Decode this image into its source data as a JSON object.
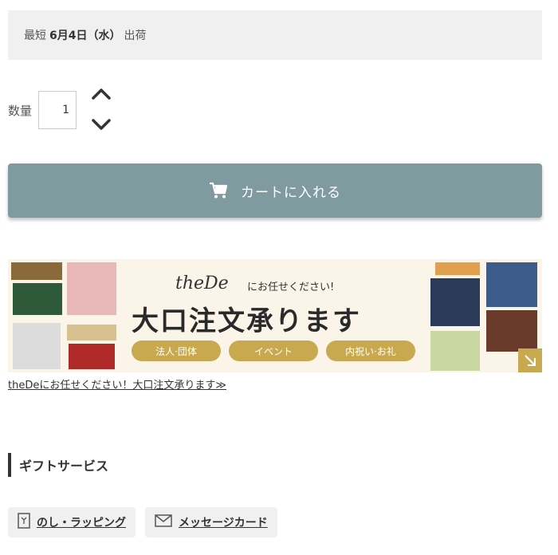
{
  "shipping": {
    "prefix": "最短",
    "date": "6月4日（水）",
    "suffix": "出荷"
  },
  "quantity": {
    "label": "数量",
    "value": "1"
  },
  "cart_button": {
    "label": "カートに入れる"
  },
  "banner": {
    "brand": "theDe",
    "brand_sub": "にお任せください!",
    "headline": "大口注文承ります",
    "pills": [
      "法人·団体",
      "イベント",
      "内祝い·お礼"
    ]
  },
  "banner_link": "theDeにお任せください！大口注文承ります≫",
  "gift_service": {
    "title": "ギフトサービス",
    "buttons": [
      {
        "label": "のし・ラッピング",
        "icon": "noshi-icon"
      },
      {
        "label": "メッセージカード",
        "icon": "envelope-icon"
      }
    ]
  },
  "colors": {
    "cart_button": "#7f9ba0",
    "pill_gold": "#c9a94f",
    "ship_bg": "#f0f0f0"
  }
}
